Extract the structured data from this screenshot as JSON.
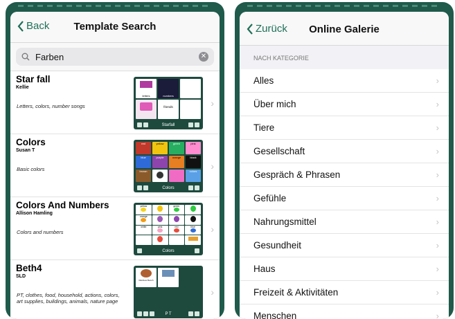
{
  "left": {
    "nav": {
      "back_label": "Back",
      "title": "Template Search"
    },
    "search": {
      "value": "Farben"
    },
    "results": [
      {
        "title": "Star fall",
        "author": "Kellie",
        "description": "Letters, colors, number songs",
        "thumb_caption": "Starfall",
        "cells": [
          "letters",
          "numbers",
          "",
          "",
          "friends",
          ""
        ]
      },
      {
        "title": "Colors",
        "author": "Susan T",
        "description": "Basic colors",
        "thumb_caption": "Colors",
        "cells": [
          "red",
          "yellow",
          "green",
          "pink",
          "blue",
          "purple",
          "orange",
          "black",
          "brown",
          "",
          "",
          "colors"
        ]
      },
      {
        "title": "Colors And Numbers",
        "author": "Allison Hamling",
        "description": "Colors and numbers",
        "thumb_caption": "Colors",
        "cells": [
          "yellow",
          "",
          "green",
          "",
          "orange",
          "",
          "",
          "",
          "white",
          "pink",
          "red",
          "blue",
          "",
          "",
          "",
          ""
        ]
      },
      {
        "title": "Beth4",
        "author": "SLD",
        "description": "PT, clothes, food, household, actions, colors, art supplies, buildings, animals, nature page",
        "thumb_caption": "P T",
        "cells": [
          "Rainbow Bunch",
          "",
          ""
        ]
      }
    ]
  },
  "right": {
    "nav": {
      "back_label": "Zurück",
      "title": "Online Galerie"
    },
    "section_header": "NACH KATEGORIE",
    "categories": [
      "Alles",
      "Über mich",
      "Tiere",
      "Gesellschaft",
      "Gespräch & Phrasen",
      "Gefühle",
      "Nahrungsmittel",
      "Gesundheit",
      "Haus",
      "Freizeit & Aktivitäten",
      "Menschen"
    ]
  },
  "theme": {
    "accent": "#1f6f58",
    "frame": "#1f5a4b",
    "thumb_bg": "#1e4a3e"
  }
}
